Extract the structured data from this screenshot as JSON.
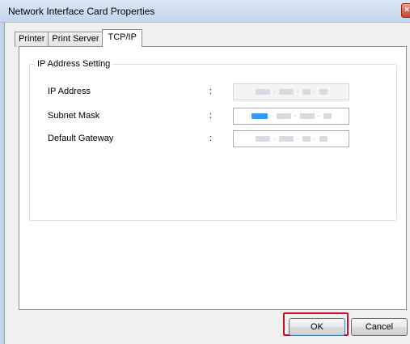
{
  "window": {
    "title": "Network Interface Card Properties",
    "close_glyph": "×"
  },
  "tabs": [
    {
      "label": "Printer"
    },
    {
      "label": "Print Server"
    },
    {
      "label": "TCP/IP"
    }
  ],
  "ip_group": {
    "title": "IP Address Setting",
    "separator": ":",
    "fields": [
      {
        "label": "IP Address",
        "state": "disabled",
        "value": "obscured"
      },
      {
        "label": "Subnet Mask",
        "state": "enabled-first-octet-selected",
        "value": "obscured"
      },
      {
        "label": "Default Gateway",
        "state": "enabled",
        "value": "obscured"
      }
    ]
  },
  "buttons": {
    "ok": "OK",
    "cancel": "Cancel"
  },
  "colors": {
    "highlight": "#c8102e",
    "selection": "#3399ff"
  }
}
